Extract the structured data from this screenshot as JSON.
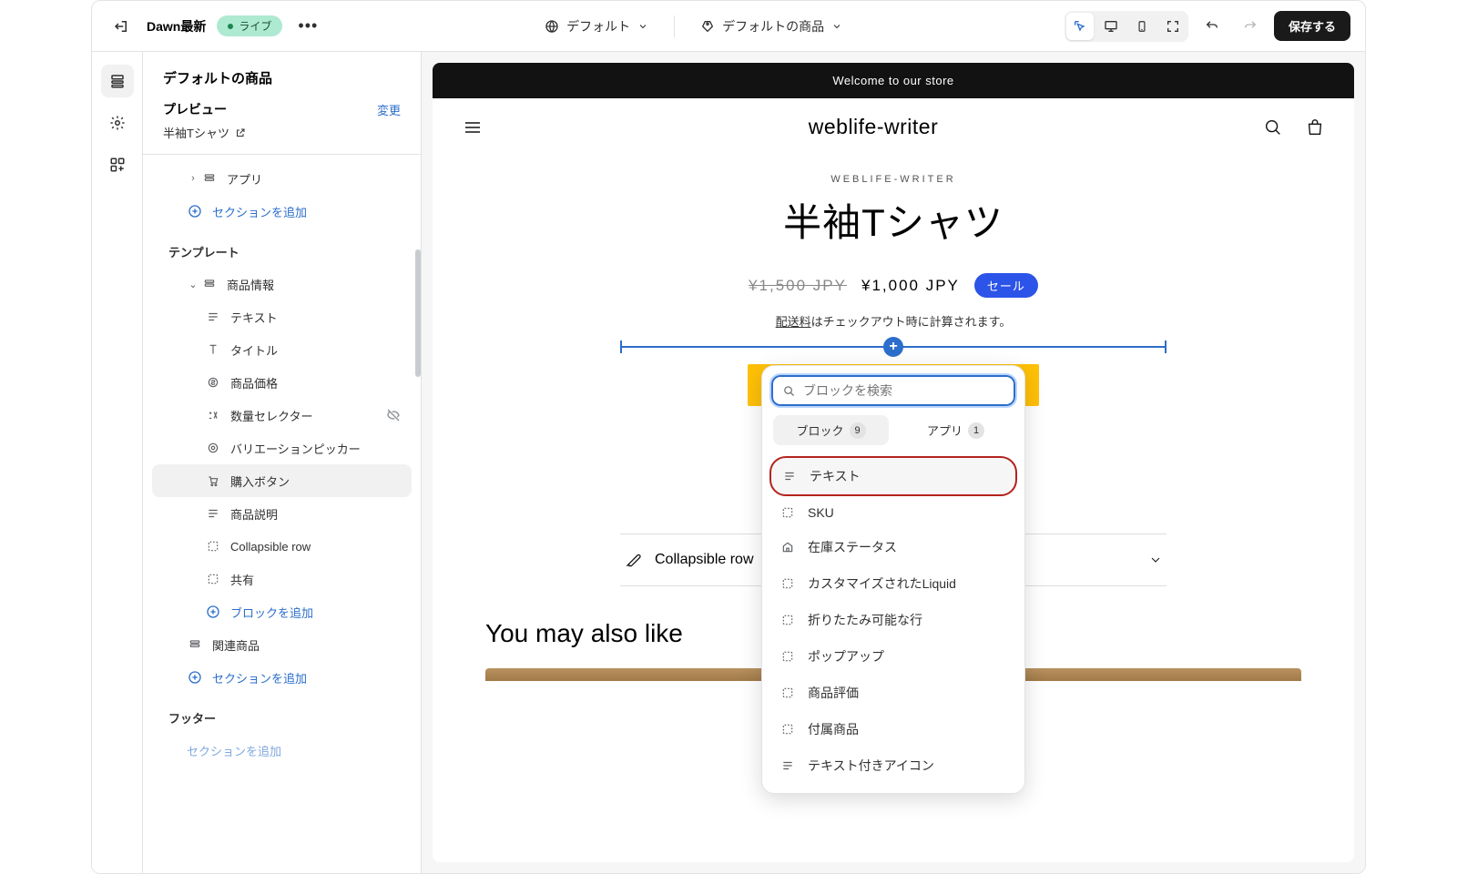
{
  "topbar": {
    "theme_name": "Dawn最新",
    "status_label": "ライブ",
    "template_selector": "デフォルト",
    "resource_selector": "デフォルトの商品",
    "save_label": "保存する"
  },
  "sidebar": {
    "header_title": "デフォルトの商品",
    "preview_label": "プレビュー",
    "change_label": "変更",
    "preview_product": "半袖Tシャツ",
    "app_label": "アプリ",
    "add_section_label": "セクションを追加",
    "template_heading": "テンプレート",
    "product_info_label": "商品情報",
    "blocks": {
      "text": "テキスト",
      "title": "タイトル",
      "price": "商品価格",
      "qty": "数量セレクター",
      "variant": "バリエーションピッカー",
      "buy": "購入ボタン",
      "desc": "商品説明",
      "collapsible": "Collapsible row",
      "share": "共有"
    },
    "add_block_label": "ブロックを追加",
    "related_label": "関連商品",
    "footer_heading": "フッター",
    "add_section_2": "セクションを追加"
  },
  "preview": {
    "announcement": "Welcome to our store",
    "store_name": "weblife-writer",
    "vendor": "WEBLIFE-WRITER",
    "product_name": "半袖Tシャツ",
    "price_compare": "¥1,500 JPY",
    "price_current": "¥1,000 JPY",
    "sale_badge": "セール",
    "shipping_link": "配送料",
    "shipping_rest": "はチェックアウト時に計算されます。",
    "collapsible_label": "Collapsible row",
    "recommend_title": "You may also like"
  },
  "popup": {
    "search_placeholder": "ブロックを検索",
    "tab_block": "ブロック",
    "tab_block_count": "9",
    "tab_app": "アプリ",
    "tab_app_count": "1",
    "items": {
      "text": "テキスト",
      "sku": "SKU",
      "stock": "在庫ステータス",
      "liquid": "カスタマイズされたLiquid",
      "collapsible": "折りたたみ可能な行",
      "popup": "ポップアップ",
      "rating": "商品評価",
      "complementary": "付属商品",
      "icon_text": "テキスト付きアイコン"
    }
  }
}
